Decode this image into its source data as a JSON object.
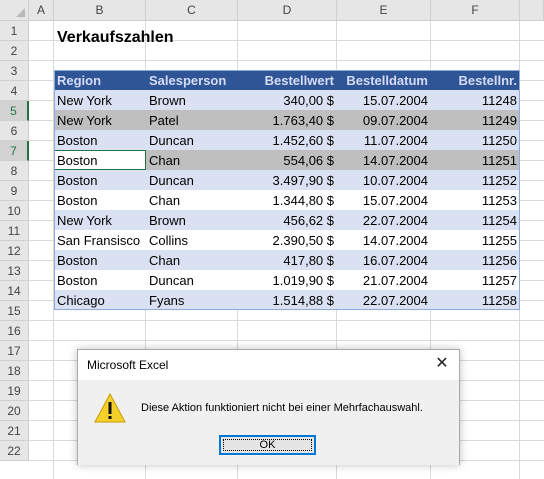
{
  "sheet": {
    "columns": [
      "A",
      "B",
      "C",
      "D",
      "E",
      "F"
    ],
    "rows": [
      "1",
      "2",
      "3",
      "4",
      "5",
      "6",
      "7",
      "8",
      "9",
      "10",
      "11",
      "12",
      "13",
      "14",
      "15",
      "16",
      "17",
      "18",
      "19",
      "20",
      "21",
      "22"
    ],
    "selected_rows": [
      "5",
      "7"
    ]
  },
  "title": "Verkaufszahlen",
  "table": {
    "headers": [
      "Region",
      "Salesperson",
      "Bestellwert",
      "Bestelldatum",
      "Bestellnr."
    ],
    "rows": [
      [
        "New York",
        "Brown",
        "340,00 $",
        "15.07.2004",
        "11248"
      ],
      [
        "New York",
        "Patel",
        "1.763,40 $",
        "09.07.2004",
        "11249"
      ],
      [
        "Boston",
        "Duncan",
        "1.452,60 $",
        "11.07.2004",
        "11250"
      ],
      [
        "Boston",
        "Chan",
        "554,06 $",
        "14.07.2004",
        "11251"
      ],
      [
        "Boston",
        "Duncan",
        "3.497,90 $",
        "10.07.2004",
        "11252"
      ],
      [
        "Boston",
        "Chan",
        "1.344,80 $",
        "15.07.2004",
        "11253"
      ],
      [
        "New York",
        "Brown",
        "456,62 $",
        "22.07.2004",
        "11254"
      ],
      [
        "San Fransisco",
        "Collins",
        "2.390,50 $",
        "14.07.2004",
        "11255"
      ],
      [
        "Boston",
        "Chan",
        "417,80 $",
        "16.07.2004",
        "11256"
      ],
      [
        "Boston",
        "Duncan",
        "1.019,90 $",
        "21.07.2004",
        "11257"
      ],
      [
        "Chicago",
        "Fyans",
        "1.514,88 $",
        "22.07.2004",
        "11258"
      ]
    ]
  },
  "colors": {
    "header_bg": "#2f5597",
    "band_light": "#d9e1f2",
    "selection": "#bfbfbf",
    "accent": "#217346"
  },
  "dialog": {
    "title": "Microsoft Excel",
    "message": "Diese Aktion funktioniert nicht bei einer Mehrfachauswahl.",
    "ok_label": "OK",
    "close_symbol": "✕",
    "icon": "warning-icon"
  }
}
